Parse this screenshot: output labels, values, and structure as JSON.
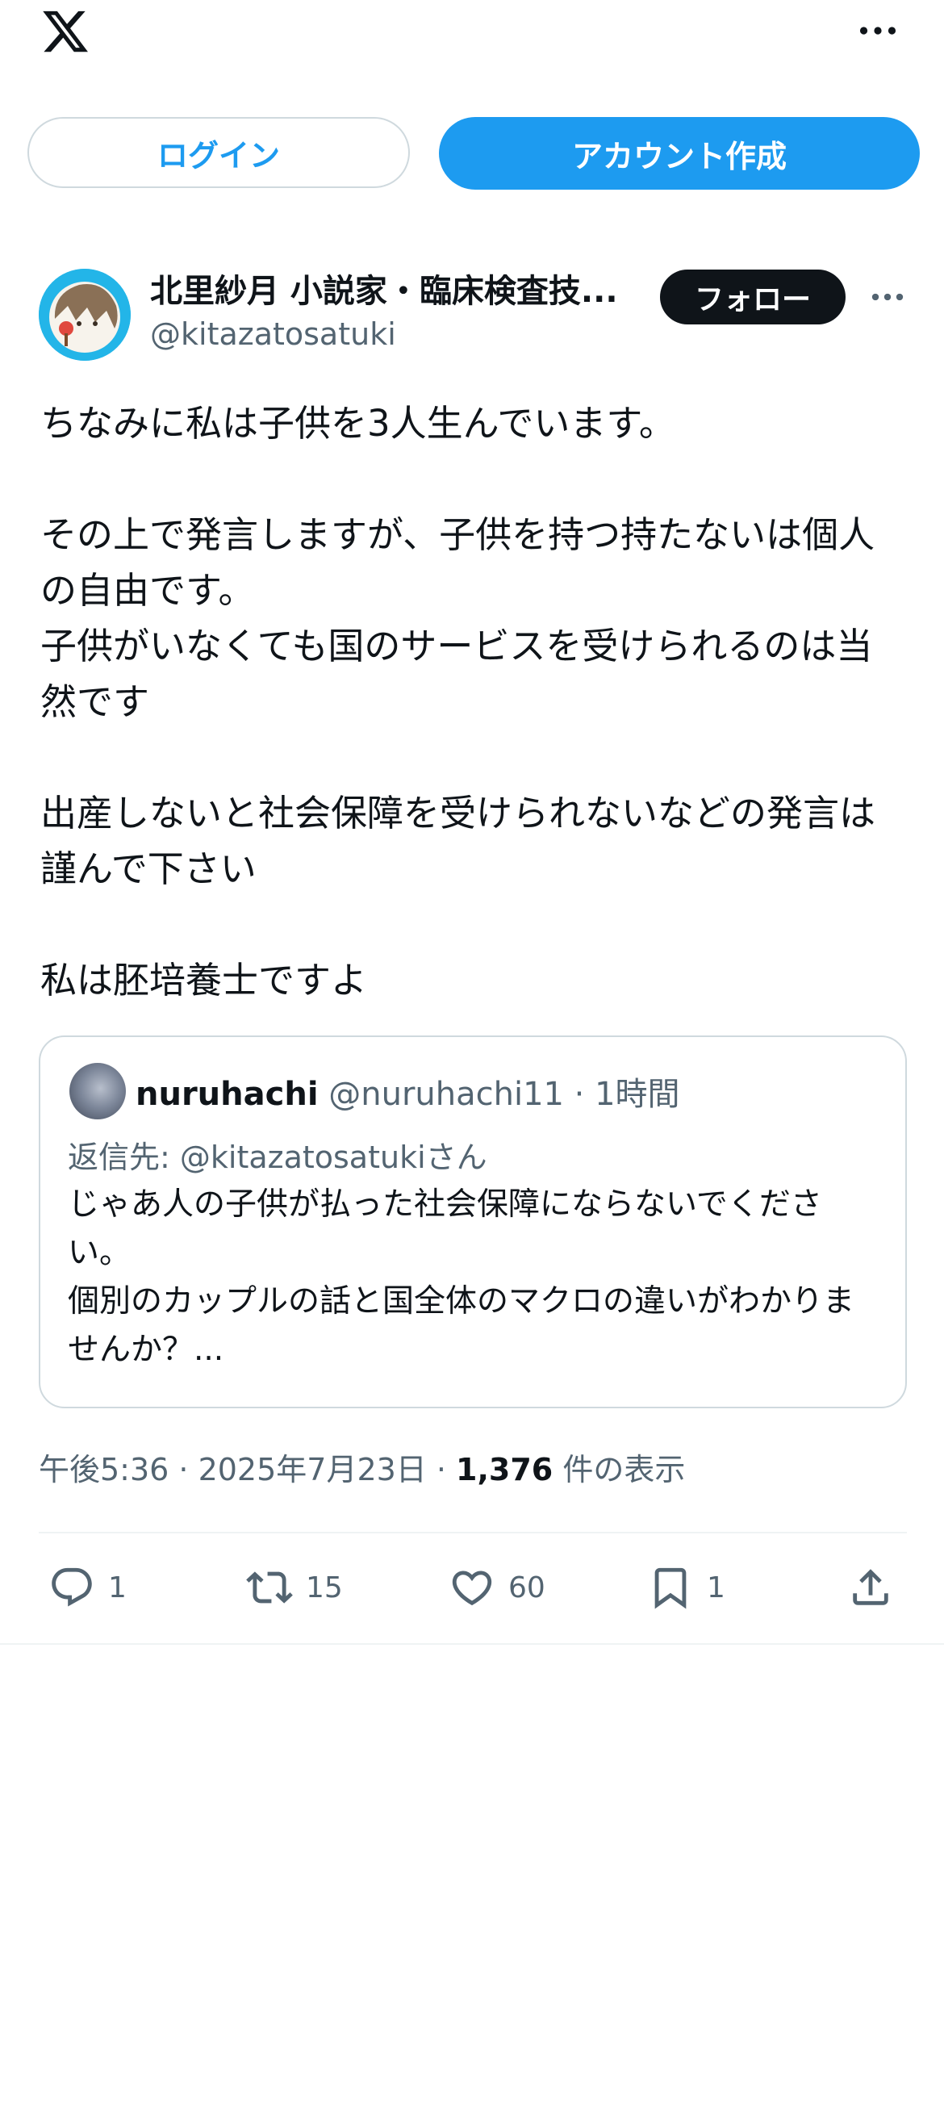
{
  "topbar": {
    "logo_icon": "x-logo-icon",
    "menu_icon": "more-horizontal-icon"
  },
  "auth": {
    "login_label": "ログイン",
    "signup_label": "アカウント作成"
  },
  "post": {
    "author_name": "北里紗月 小説家・臨床検査技...",
    "author_handle": "@kitazatosatuki",
    "follow_label": "フォロー",
    "text": "ちなみに私は子供を3人生んでいます。\n\nその上で発言しますが、子供を持つ持たないは個人の自由です。\n子供がいなくても国のサービスを受けられるのは当然です\n\n出産しないと社会保障を受けられないなどの発言は謹んで下さい\n\n私は胚培養士ですよ",
    "timestamp": "午後5:36 · 2025年7月23日 · ",
    "views_count": "1,376",
    "views_label": " 件の表示"
  },
  "quote": {
    "name": "nuruhachi",
    "handle_time": " @nuruhachi11 · 1時間",
    "reply_to": "返信先: @kitazatosatukiさん",
    "text": "じゃあ人の子供が払った社会保障にならないでください。\n個別のカップルの話と国全体のマクロの違いがわかりませんか？..."
  },
  "actions": {
    "replies": "1",
    "reposts": "15",
    "likes": "60",
    "bookmarks": "1"
  },
  "colors": {
    "accent": "#1d9bf0",
    "text_primary": "#0f1419",
    "text_secondary": "#536471",
    "border": "#cfd9de"
  }
}
